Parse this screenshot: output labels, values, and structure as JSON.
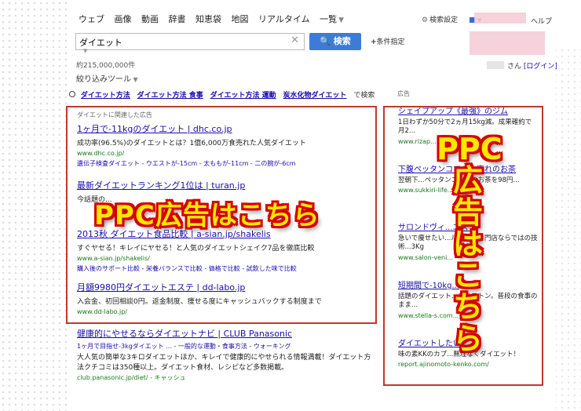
{
  "nav": {
    "items": [
      "ウェブ",
      "画像",
      "動画",
      "辞書",
      "知恵袋",
      "地図",
      "リアルタイム",
      "一覧"
    ],
    "search_settings": "検索設定",
    "help": "ヘルプ"
  },
  "search": {
    "query": "ダイエット",
    "button": "検索",
    "conditions": "条件指定"
  },
  "results_count": "約215,000,000件",
  "user": {
    "suffix": "さん",
    "login": "[ログイン]"
  },
  "filter_tools": "絞り込みツール",
  "related": {
    "items": [
      "ダイエット方法",
      "ダイエット方法 食事",
      "ダイエット方法 運動",
      "炭水化物ダイエット"
    ],
    "suffix": "で検索"
  },
  "ads_left": {
    "header": "ダイエットに関連した広告",
    "items": [
      {
        "title": "1ヶ月で-11kgのダイエット | dhc.co.jp",
        "desc": "成功率(96.5%)のダイエットとは？1億6,000万食売れた人気ダイエット",
        "url": "www.dhc.co.jp/",
        "sitelinks": "遺伝子検査ダイエット - ウエストが-15cm - 太ももが-11cm - 二の腕が-6cm"
      },
      {
        "title": "最新ダイエットランキング1位は | turan.jp",
        "desc": "今話題の...",
        "url": "",
        "sitelinks": ""
      },
      {
        "title": "2013秋 ダイエット食品比較 | a-sian.jp/shakelis",
        "desc": "すぐヤセる！キレイにヤセる！と人気のダイエットシェイク7品を徹底比較",
        "url": "www.a-sian.jp/shakelis/",
        "sitelinks": "購入後のサポート比較 - 栄養バランスで比較 - 価格で比較 - 試飲した味で比較"
      },
      {
        "title": "月額9980円ダイエットエステ | dd-labo.jp",
        "desc": "入会金、初回相談0円。返金制度、痩せる度にキャッシュバックする制度まで",
        "url": "www.dd-labo.jp/",
        "sitelinks": ""
      }
    ]
  },
  "ads_right": {
    "header": "広告",
    "items": [
      {
        "title": "シェイプアップ《最強》のジム",
        "desc": "1日わずか50分で2ヵ月15kg減。成果確約で月2...",
        "url": "www.rizap..."
      },
      {
        "title": "下腹ペッタンコでバカ売れのお茶",
        "desc": "翌朝下...ペッタンコ？噂のお茶を98円...",
        "url": "www.sukkiri-life..."
      },
      {
        "title": "サロンドヴィ...エステ",
        "desc": "急いで痩せたい...ルライト専門店ならではの技術...3Kg",
        "url": "www.salon-veni..."
      },
      {
        "title": "短期間で-10kg...",
        "desc": "話題のダイエット...コリストン。普段の食事のまま...",
        "url": "www.stella-s.com..."
      },
      {
        "title": "ダイエットしたい...",
        "desc": "味の素KKのカプ...無理なくダイエット！",
        "url": "report.ajinomoto-kenko.com/"
      }
    ]
  },
  "organic": {
    "title": "健康的にやせるならダイエットナビ | CLUB Panasonic",
    "sitelinks": "1ヶ月で目指せ-3kgダイエット ... - 一般的な運動・食事方法 - ウォーキング",
    "desc1": "大人気の簡単な3キロダイエットほか、キレイで健康的にやせられる情報満載！ダイエット方法クチコミは350種以上。ダイエット食材、レシピなど多数掲載。",
    "url": "club.panasonic.jp/diet/ - キャッシュ"
  },
  "overlay": {
    "left": "PPC広告はこちら",
    "right_lines": [
      "PPC",
      "広",
      "告",
      "は",
      "こ",
      "ち",
      "ら"
    ]
  },
  "colors": {
    "overlay_fill": "#ffe600",
    "overlay_stroke": "#d40000",
    "frame": "#c0392b",
    "search_button": "#3d7bd6"
  }
}
